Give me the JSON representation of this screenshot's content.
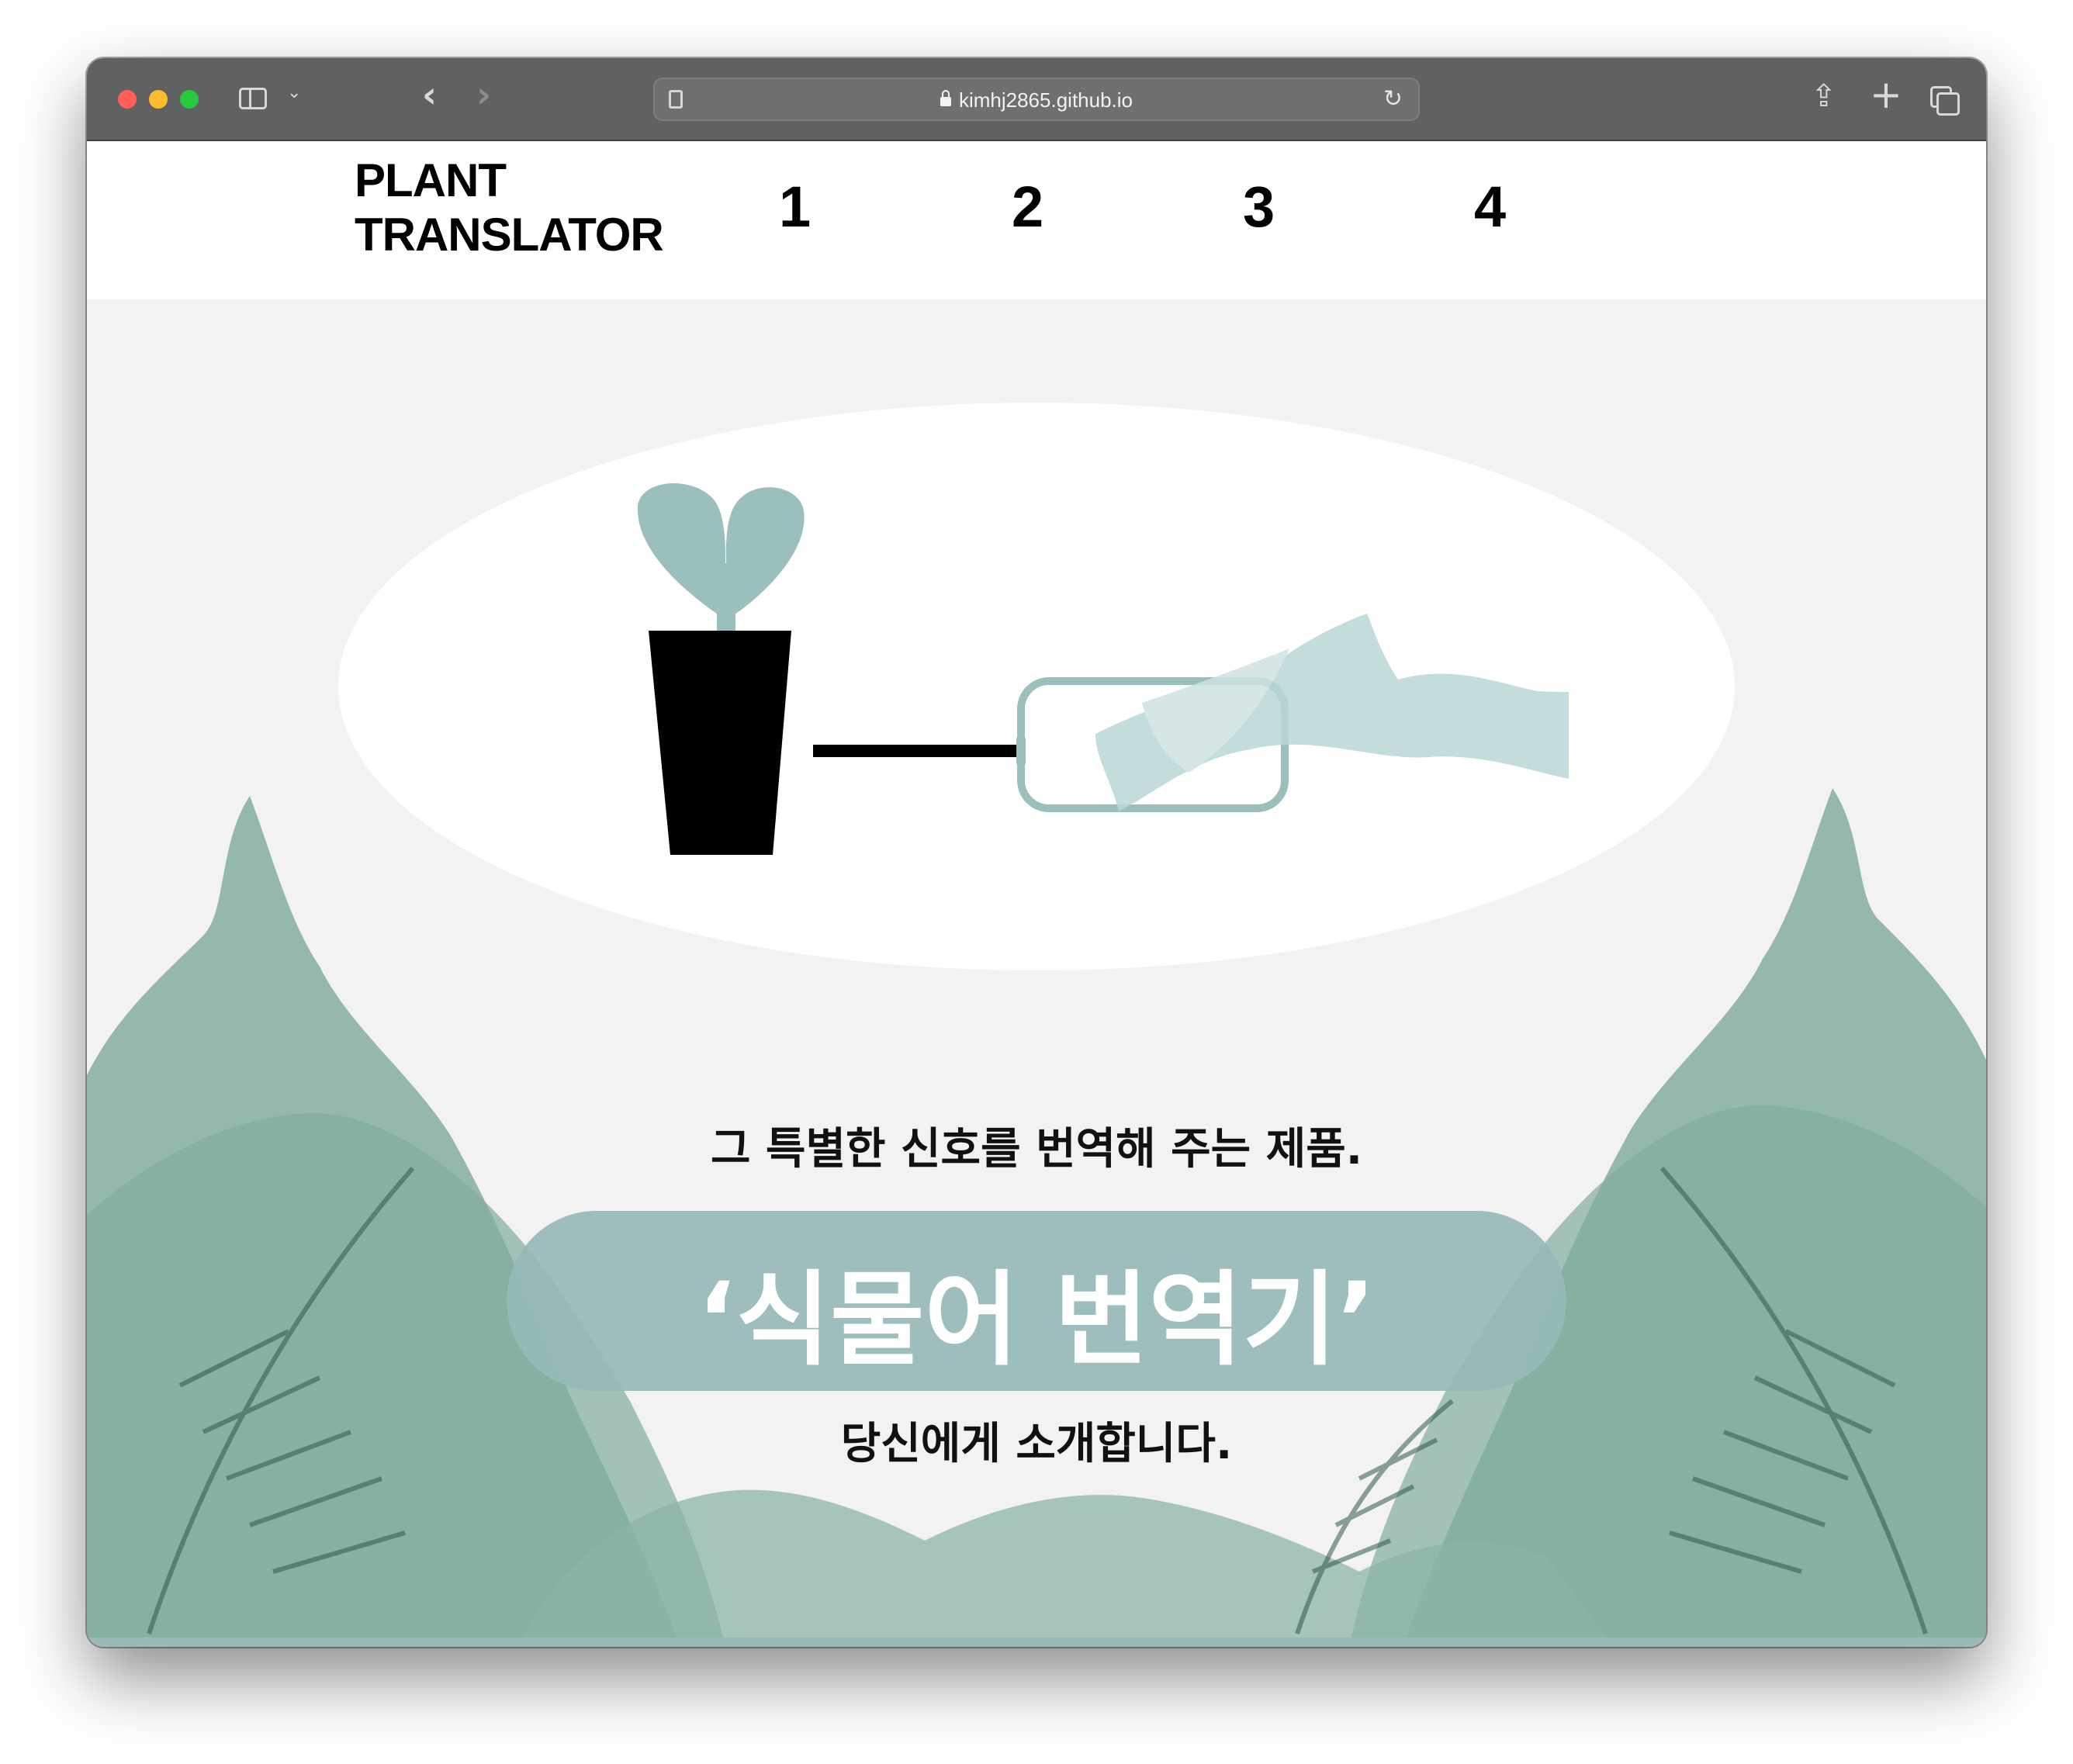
{
  "browser": {
    "url": "kimhj2865.github.io",
    "icons": [
      "sidebar-icon",
      "chevron-down-icon",
      "back-icon",
      "forward-icon",
      "reader-icon",
      "lock-icon",
      "reload-icon",
      "share-icon",
      "plus-icon",
      "tabs-icon"
    ]
  },
  "header": {
    "logo_line1": "PLANT",
    "logo_line2": "TRANSLATOR",
    "nav": [
      "1",
      "2",
      "3",
      "4"
    ]
  },
  "hero": {
    "line_top": "그 특별한 신호를 번역해 주는 제품.",
    "product_name": "‘식물어 번역기’",
    "line_bottom": "당신에게 소개합니다."
  },
  "colors": {
    "accent": "#96bab8",
    "wave": "#b9d6d6",
    "leaf": "#5f9a86",
    "background": "#f2f2f2"
  }
}
